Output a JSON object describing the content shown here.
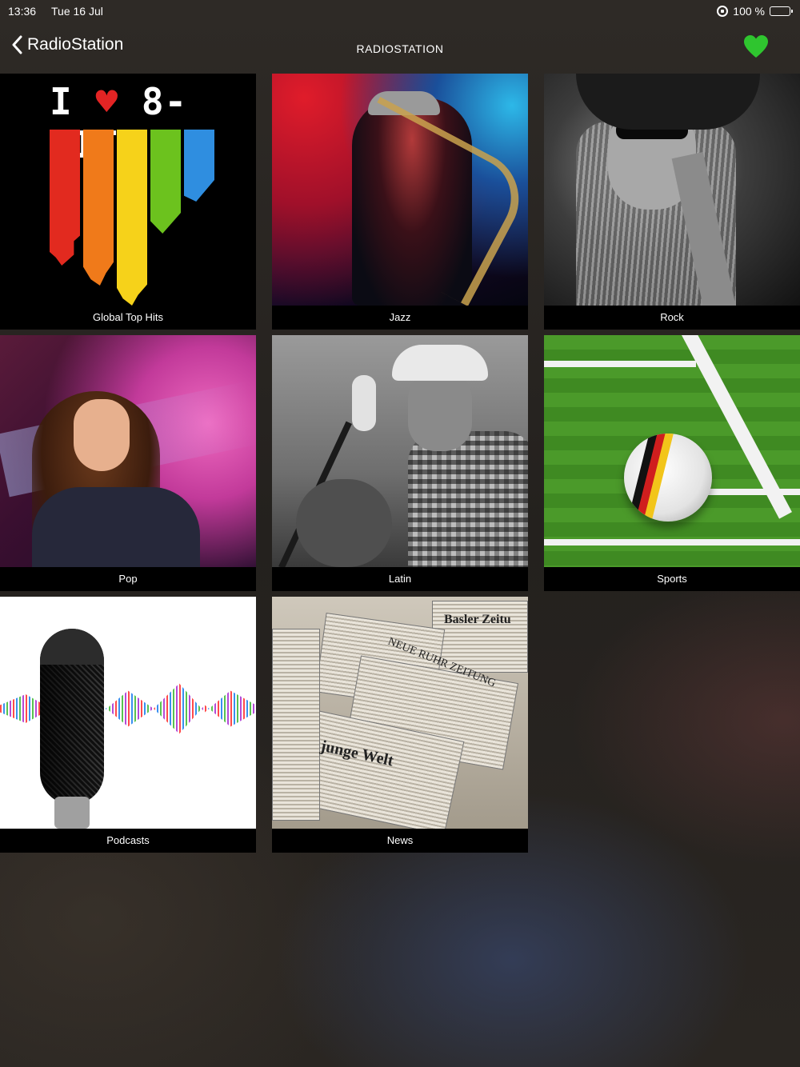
{
  "status_bar": {
    "time": "13:36",
    "date": "Tue 16 Jul",
    "battery": "100 %"
  },
  "nav": {
    "back_label": "RadioStation",
    "title": "RADIOSTATION",
    "favorite_color": "#2fc52f"
  },
  "tiles": [
    {
      "label": "Global Top Hits",
      "logo_text_left": "I",
      "logo_text_right": "8-BIT"
    },
    {
      "label": "Jazz"
    },
    {
      "label": "Rock"
    },
    {
      "label": "Pop"
    },
    {
      "label": "Latin"
    },
    {
      "label": "Sports"
    },
    {
      "label": "Podcasts"
    },
    {
      "label": "News",
      "paper_titles": [
        "Basler Zeitu",
        "NEUE RUHR ZEITUNG",
        "junge Welt"
      ]
    }
  ]
}
